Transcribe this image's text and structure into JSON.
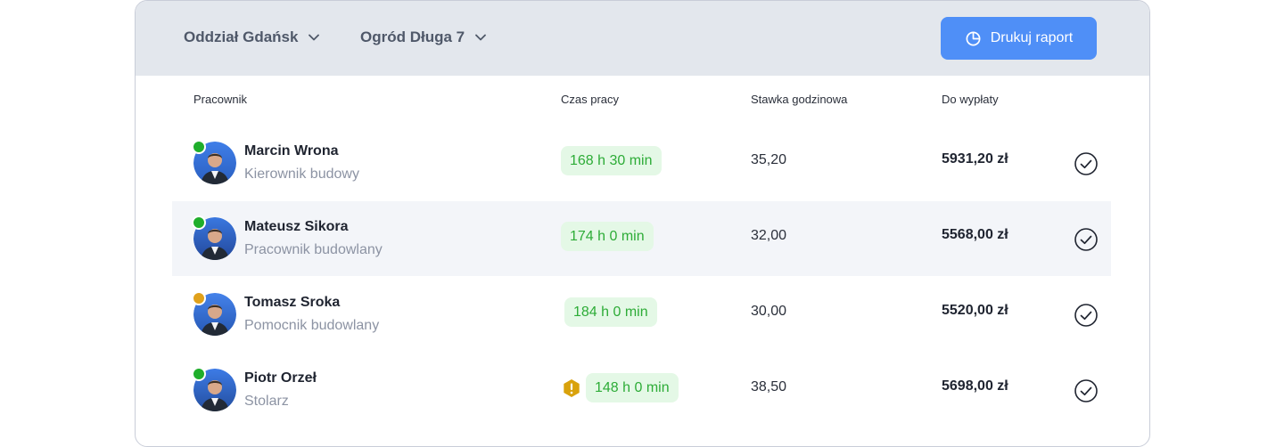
{
  "toolbar": {
    "branch_dropdown": "Oddział Gdańsk",
    "site_dropdown": "Ogród Długa 7",
    "print_button": "Drukuj raport"
  },
  "table": {
    "columns": [
      "Pracownik",
      "Czas pracy",
      "Stawka godzinowa",
      "Do wypłaty"
    ],
    "rows": [
      {
        "name": "Marcin Wrona",
        "role": "Kierownik budowy",
        "status": "green",
        "hours": "168 h 30 min",
        "rate": "35,20",
        "payout": "5931,20 zł",
        "warning": false
      },
      {
        "name": "Mateusz Sikora",
        "role": "Pracownik budowlany",
        "status": "green",
        "hours": "174 h 0 min",
        "rate": "32,00",
        "payout": "5568,00 zł",
        "warning": false
      },
      {
        "name": "Tomasz Sroka",
        "role": "Pomocnik budowlany",
        "status": "orange",
        "hours": "184 h 0 min",
        "rate": "30,00",
        "payout": "5520,00 zł",
        "warning": false
      },
      {
        "name": "Piotr Orzeł",
        "role": "Stolarz",
        "status": "green",
        "hours": "148 h 0 min",
        "rate": "38,50",
        "payout": "5698,00 zł",
        "warning": true
      }
    ]
  },
  "colors": {
    "accent": "#4f8ff7",
    "status_green": "#1fae2b",
    "status_orange": "#e0a11b",
    "badge_bg": "#e4f8e6",
    "badge_text": "#2dac37",
    "warning": "#d9a20c"
  },
  "icons": {
    "dropdown": "chevron-down-icon",
    "print": "pie-chart-icon",
    "approve": "check-circle-icon",
    "warning": "warning-hexagon-icon"
  }
}
